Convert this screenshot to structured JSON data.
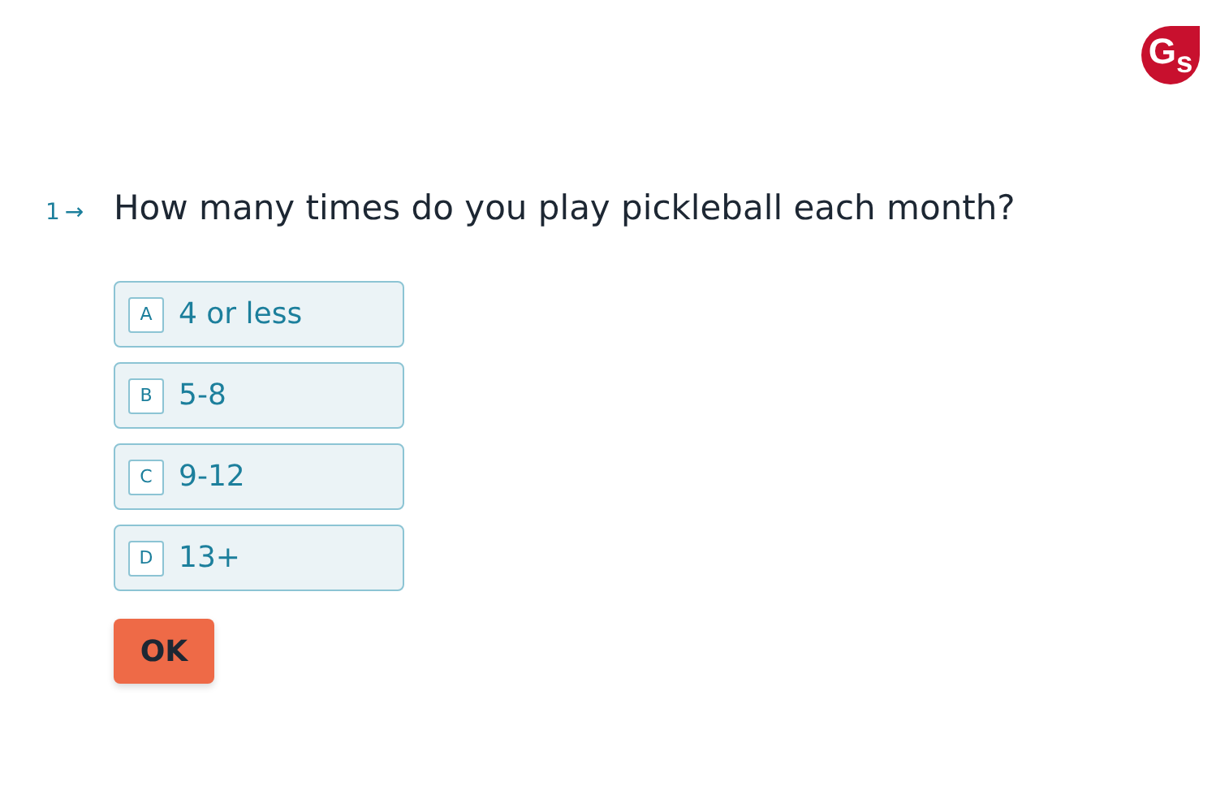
{
  "logo": {
    "text": "G$_{s}$"
  },
  "question": {
    "number": "1",
    "arrow": "→",
    "text": "How many times do you play pickleball each month?"
  },
  "options": [
    {
      "key": "A",
      "label": "4 or less",
      "selected": false
    },
    {
      "key": "B",
      "label": "5-8",
      "selected": false
    },
    {
      "key": "C",
      "label": "9-12",
      "selected": false
    },
    {
      "key": "D",
      "label": "13+",
      "selected": false
    }
  ],
  "submit": {
    "label": "OK"
  }
}
